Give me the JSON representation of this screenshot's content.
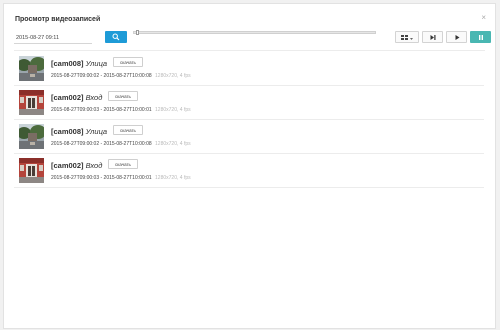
{
  "window": {
    "title": "Просмотр видеозаписей",
    "close_glyph": "×"
  },
  "search": {
    "date_value": "2015-08-27 09:11"
  },
  "controls": {
    "accent": "#1e9bd7",
    "pause_color": "#49b7b2",
    "timeline_position": 0.01
  },
  "records": [
    {
      "camera": "[cam008]",
      "location": "Улица",
      "download_label": "скачать",
      "range": "2015-08-27T09:00:02 - 2015-08-27T10:00:08",
      "meta": "1280x720, 4 fps",
      "thumb": "street"
    },
    {
      "camera": "[cam002]",
      "location": "Вход",
      "download_label": "скачать",
      "range": "2015-08-27T09:00:03 - 2015-08-27T10:00:01",
      "meta": "1280x720, 4 fps",
      "thumb": "entrance"
    },
    {
      "camera": "[cam008]",
      "location": "Улица",
      "download_label": "скачать",
      "range": "2015-08-27T09:00:02 - 2015-08-27T10:00:08",
      "meta": "1280x720, 4 fps",
      "thumb": "street"
    },
    {
      "camera": "[cam002]",
      "location": "Вход",
      "download_label": "скачать",
      "range": "2015-08-27T09:00:03 - 2015-08-27T10:00:01",
      "meta": "1280x720, 4 fps",
      "thumb": "entrance"
    }
  ]
}
